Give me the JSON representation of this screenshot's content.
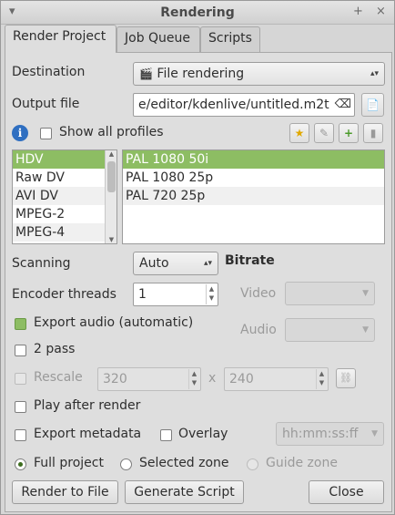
{
  "window": {
    "title": "Rendering",
    "menu_glyph": "▾",
    "pin_glyph": "+",
    "close_glyph": "×"
  },
  "tabs": [
    {
      "label": "Render Project",
      "active": true
    },
    {
      "label": "Job Queue",
      "active": false
    },
    {
      "label": "Scripts",
      "active": false
    }
  ],
  "destination": {
    "label": "Destination",
    "value": "File rendering",
    "icon": "film-icon",
    "icon_glyph": "🎬",
    "arrow_glyph": "▴▾"
  },
  "output_file": {
    "label": "Output file",
    "value": "e/editor/kdenlive/untitled.m2t",
    "clear_glyph": "⌫",
    "browse_icon": "file-browse-icon",
    "browse_glyph": "📄"
  },
  "profiles_toolbar": {
    "info_glyph": "i",
    "show_all_label": "Show all profiles",
    "show_all_checked": false,
    "favorite_glyph": "★",
    "edit_glyph": "✎",
    "new_glyph": "+",
    "delete_glyph": "▮"
  },
  "formats": {
    "items": [
      "HDV",
      "Raw DV",
      "AVI DV",
      "MPEG-2",
      "MPEG-4"
    ],
    "selected_index": 0
  },
  "profiles": {
    "items": [
      "PAL 1080 50i",
      "PAL 1080 25p",
      "PAL 720 25p"
    ],
    "selected_index": 0
  },
  "scanning": {
    "label": "Scanning",
    "value": "Auto"
  },
  "encoder_threads": {
    "label": "Encoder threads",
    "value": "1"
  },
  "bitrate": {
    "heading": "Bitrate",
    "video_label": "Video",
    "audio_label": "Audio"
  },
  "export_audio": {
    "label": "Export audio (automatic)",
    "checked": true
  },
  "two_pass": {
    "label": "2 pass",
    "checked": false
  },
  "rescale": {
    "label": "Rescale",
    "width": "320",
    "separator": "x",
    "height": "240",
    "checked": false
  },
  "play_after_render": {
    "label": "Play after render",
    "checked": false
  },
  "export_metadata": {
    "label": "Export metadata",
    "checked": false
  },
  "overlay": {
    "label": "Overlay",
    "checked": false,
    "placeholder": "hh:mm:ss:ff"
  },
  "zones": {
    "full_project": "Full project",
    "selected_zone": "Selected zone",
    "guide_zone": "Guide zone",
    "selected": "full_project"
  },
  "buttons": {
    "render_to_file": "Render to File",
    "generate_script": "Generate Script",
    "close": "Close"
  },
  "colors": {
    "selection": "#8dbd63",
    "window_bg": "#d6d6d6"
  }
}
